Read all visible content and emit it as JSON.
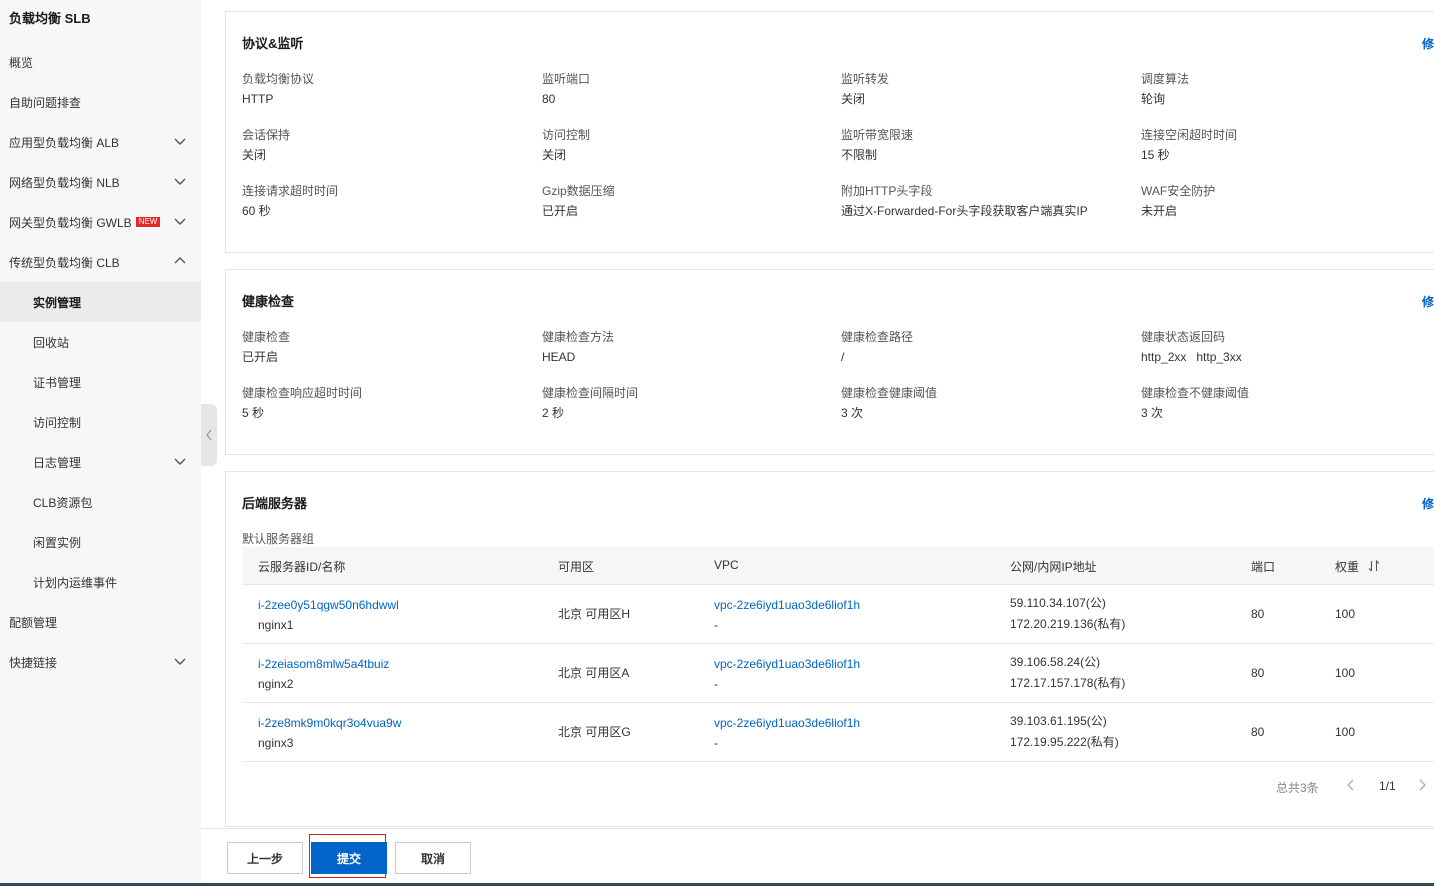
{
  "sidebar": {
    "title": "负载均衡 SLB",
    "items": [
      {
        "label": "概览"
      },
      {
        "label": "自助问题排查"
      },
      {
        "label": "应用型负载均衡 ALB"
      },
      {
        "label": "网络型负载均衡 NLB"
      },
      {
        "label": "网关型负载均衡 GWLB",
        "badge": "NEW"
      },
      {
        "label": "传统型负载均衡 CLB"
      },
      {
        "label": "实例管理"
      },
      {
        "label": "回收站"
      },
      {
        "label": "证书管理"
      },
      {
        "label": "访问控制"
      },
      {
        "label": "日志管理"
      },
      {
        "label": "CLB资源包"
      },
      {
        "label": "闲置实例"
      },
      {
        "label": "计划内运维事件"
      },
      {
        "label": "配额管理"
      },
      {
        "label": "快捷链接"
      }
    ]
  },
  "protocol": {
    "title": "协议&监听",
    "edit": "修改",
    "fields": [
      {
        "label": "负载均衡协议",
        "value": "HTTP"
      },
      {
        "label": "监听端口",
        "value": "80"
      },
      {
        "label": "监听转发",
        "value": "关闭"
      },
      {
        "label": "调度算法",
        "value": "轮询"
      },
      {
        "label": "会话保持",
        "value": "关闭"
      },
      {
        "label": "访问控制",
        "value": "关闭"
      },
      {
        "label": "监听带宽限速",
        "value": "不限制"
      },
      {
        "label": "连接空闲超时时间",
        "value": "15 秒"
      },
      {
        "label": "连接请求超时时间",
        "value": "60 秒"
      },
      {
        "label": "Gzip数据压缩",
        "value": "已开启"
      },
      {
        "label": "附加HTTP头字段",
        "value": "通过X-Forwarded-For头字段获取客户端真实IP"
      },
      {
        "label": "WAF安全防护",
        "value": "未开启"
      }
    ]
  },
  "health": {
    "title": "健康检查",
    "edit": "修改",
    "fields": [
      {
        "label": "健康检查",
        "value": "已开启"
      },
      {
        "label": "健康检查方法",
        "value": "HEAD"
      },
      {
        "label": "健康检查路径",
        "value": "/"
      },
      {
        "label": "健康状态返回码",
        "value": "http_2xx   http_3xx"
      },
      {
        "label": "健康检查响应超时时间",
        "value": "5 秒"
      },
      {
        "label": "健康检查间隔时间",
        "value": "2 秒"
      },
      {
        "label": "健康检查健康阈值",
        "value": "3 次"
      },
      {
        "label": "健康检查不健康阈值",
        "value": "3 次"
      }
    ]
  },
  "backend": {
    "title": "后端服务器",
    "edit": "修改",
    "group_label": "默认服务器组",
    "columns": {
      "id": "云服务器ID/名称",
      "zone": "可用区",
      "vpc": "VPC",
      "ip": "公网/内网IP地址",
      "port": "端口",
      "weight": "权重"
    },
    "rows": [
      {
        "id": "i-2zee0y51qgw50n6hdwwl",
        "name": "nginx1",
        "zone": "北京 可用区H",
        "vpc": "vpc-2ze6iyd1uao3de6liof1h",
        "vpc_sub": "-",
        "public_ip": "59.110.34.107(公)",
        "private_ip": "172.20.219.136(私有)",
        "port": "80",
        "weight": "100"
      },
      {
        "id": "i-2zeiasom8mlw5a4tbuiz",
        "name": "nginx2",
        "zone": "北京 可用区A",
        "vpc": "vpc-2ze6iyd1uao3de6liof1h",
        "vpc_sub": "-",
        "public_ip": "39.106.58.24(公)",
        "private_ip": "172.17.157.178(私有)",
        "port": "80",
        "weight": "100"
      },
      {
        "id": "i-2ze8mk9m0kqr3o4vua9w",
        "name": "nginx3",
        "zone": "北京 可用区G",
        "vpc": "vpc-2ze6iyd1uao3de6liof1h",
        "vpc_sub": "-",
        "public_ip": "39.103.61.195(公)",
        "private_ip": "172.19.95.222(私有)",
        "port": "80",
        "weight": "100"
      }
    ],
    "pager": {
      "total": "总共3条",
      "page": "1/1"
    }
  },
  "footer": {
    "prev": "上一步",
    "submit": "提交",
    "cancel": "取消"
  },
  "colors": {
    "accent": "#0064c8",
    "highlight": "#e0191f",
    "badge": "#e5292a"
  }
}
